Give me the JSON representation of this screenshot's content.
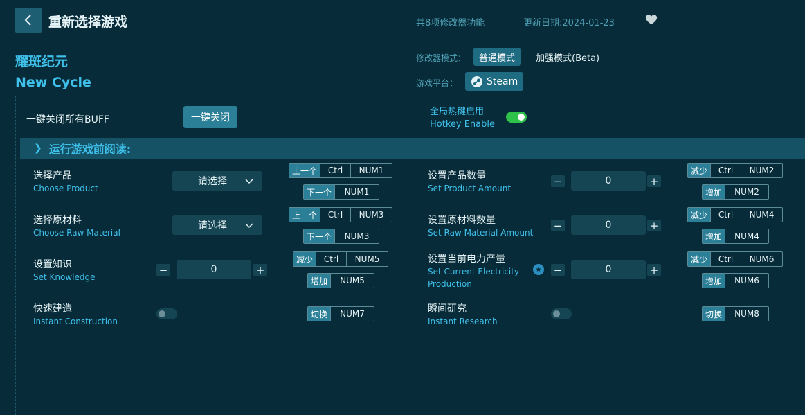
{
  "header": {
    "title": "重新选择游戏",
    "feature_count": "共8项修改器功能",
    "update_date": "更新日期:2024-01-23"
  },
  "game": {
    "name_cn": "耀斑纪元",
    "name_en": "New Cycle"
  },
  "mode": {
    "label": "修改器模式：",
    "normal": "普通模式",
    "enhanced": "加强模式(Beta)"
  },
  "platform": {
    "label": "游戏平台：",
    "name": "Steam"
  },
  "buff": {
    "label": "一键关闭所有BUFF",
    "button": "一键关闭"
  },
  "hotkey": {
    "title_cn": "全局热键启用",
    "title_en": "Hotkey Enable",
    "enabled": true
  },
  "read_bar": {
    "label": "运行游戏前阅读:"
  },
  "options": {
    "choose_product": {
      "cn": "选择产品",
      "en": "Choose Product",
      "value": "请选择",
      "hk1": {
        "tag": "上一个",
        "k1": "Ctrl",
        "k2": "NUM1"
      },
      "hk2": {
        "tag": "下一个",
        "k1": "NUM1"
      }
    },
    "choose_raw": {
      "cn": "选择原材料",
      "en": "Choose Raw Material",
      "value": "请选择",
      "hk1": {
        "tag": "上一个",
        "k1": "Ctrl",
        "k2": "NUM3"
      },
      "hk2": {
        "tag": "下一个",
        "k1": "NUM3"
      }
    },
    "knowledge": {
      "cn": "设置知识",
      "en": "Set Knowledge",
      "value": "0",
      "hk1": {
        "tag": "减少",
        "k1": "Ctrl",
        "k2": "NUM5"
      },
      "hk2": {
        "tag": "增加",
        "k1": "NUM5"
      }
    },
    "instant_construction": {
      "cn": "快速建造",
      "en": "Instant Construction",
      "enabled": false,
      "hk1": {
        "tag": "切换",
        "k1": "NUM7"
      }
    },
    "product_amount": {
      "cn": "设置产品数量",
      "en": "Set Product Amount",
      "value": "0",
      "hk1": {
        "tag": "减少",
        "k1": "Ctrl",
        "k2": "NUM2"
      },
      "hk2": {
        "tag": "增加",
        "k1": "NUM2"
      }
    },
    "raw_amount": {
      "cn": "设置原材料数量",
      "en": "Set Raw Material Amount",
      "value": "0",
      "hk1": {
        "tag": "减少",
        "k1": "Ctrl",
        "k2": "NUM4"
      },
      "hk2": {
        "tag": "增加",
        "k1": "NUM4"
      }
    },
    "electricity": {
      "cn": "设置当前电力产量",
      "en": "Set Current Electricity",
      "en2": "Production",
      "value": "0",
      "hk1": {
        "tag": "减少",
        "k1": "Ctrl",
        "k2": "NUM6"
      },
      "hk2": {
        "tag": "增加",
        "k1": "NUM6"
      }
    },
    "instant_research": {
      "cn": "瞬间研究",
      "en": "Instant Research",
      "enabled": false,
      "hk1": {
        "tag": "切换",
        "k1": "NUM8"
      }
    }
  },
  "stepper": {
    "minus": "−",
    "plus": "+"
  },
  "colors": {
    "background": "#072b38",
    "accent": "#3fc0ea",
    "button": "#2b7f97",
    "toggle_on": "#2ec24a"
  }
}
